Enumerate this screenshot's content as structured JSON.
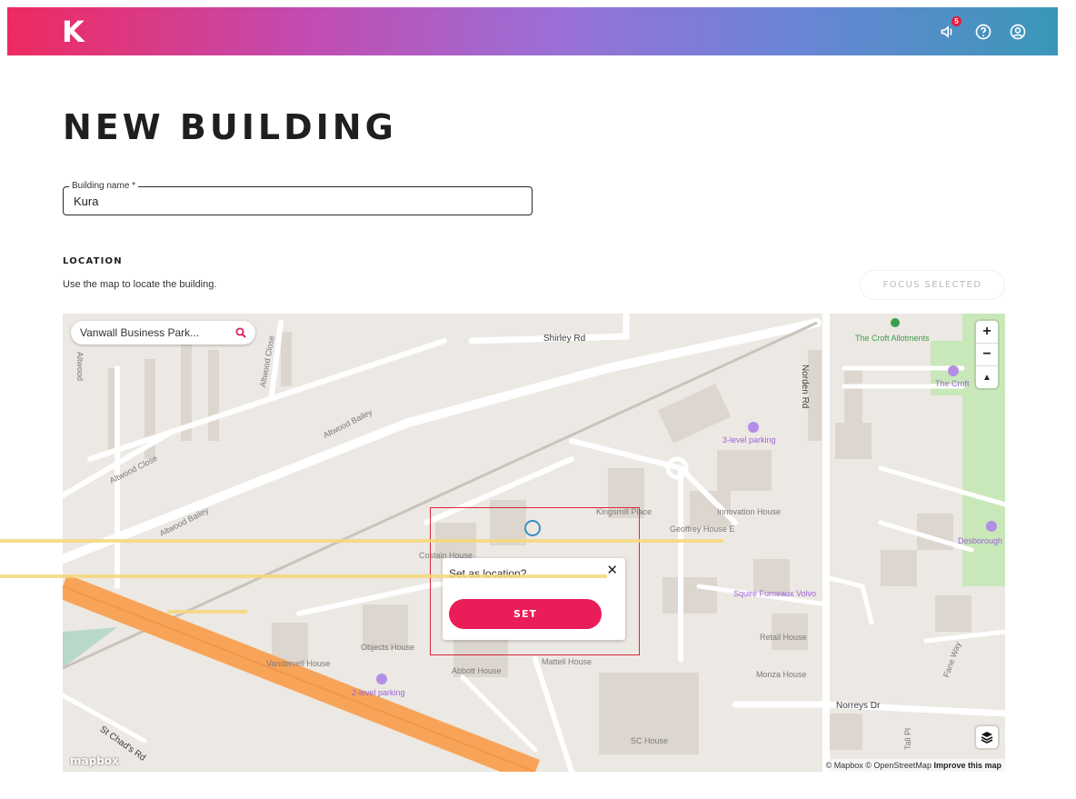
{
  "header": {
    "logo_text": "K",
    "notification_count": "5",
    "icons": [
      "megaphone-icon",
      "help-icon",
      "account-icon"
    ]
  },
  "page": {
    "title": "NEW BUILDING"
  },
  "form": {
    "building_name_label": "Building name *",
    "building_name_value": "Kura"
  },
  "location": {
    "section_title": "LOCATION",
    "help_text": "Use the map to locate the building.",
    "focus_button_label": "FOCUS SELECTED"
  },
  "map": {
    "search_value": "Vanwall Business Park...",
    "zoom_in_label": "+",
    "zoom_out_label": "−",
    "compass_label": "▲",
    "attribution_text": "© Mapbox © OpenStreetMap",
    "improve_link": "Improve this map",
    "logo_text": "mapbox",
    "labels": {
      "shirley_rd": "Shirley Rd",
      "norden_rd": "Norden Rd",
      "altwood": "Altwood",
      "altwood_close_1": "Altwood Close",
      "altwood_close_2": "Altwood Close",
      "altwood_bailey_1": "Altwood Bailey",
      "altwood_bailey_2": "Altwood Bailey",
      "croft_allotments": "The Croft Allotments",
      "the_croft": "The Croft",
      "three_level_parking": "3-level parking",
      "two_level_parking": "2-level parking",
      "kingsmill_place": "Kingsmill Place",
      "innovation_house": "Innovation House",
      "geoffrey_house": "Geoffrey House E",
      "costain_house": "Costain House",
      "objects_house": "Objects House",
      "vandervell_house": "Vandervell House",
      "abbott_house": "Abbott House",
      "mattell_house": "Mattell House",
      "squire_furneaux": "Squire Furneaux Volvo",
      "retail_house": "Retail House",
      "monza_house": "Monza House",
      "norreys_dr": "Norreys Dr",
      "sc_house": "SC House",
      "st_chads_rd": "St Chad's Rd",
      "fane_way": "Fane Way",
      "desborough": "Desborough",
      "tall_pl": "Tall Pl"
    },
    "popup": {
      "question": "Set as location?",
      "close_label": "✕",
      "set_label": "SET"
    }
  },
  "colors": {
    "accent": "#ea1d58",
    "highlight_box": "#d9253a",
    "overlay_lines": "#f6d77a"
  }
}
